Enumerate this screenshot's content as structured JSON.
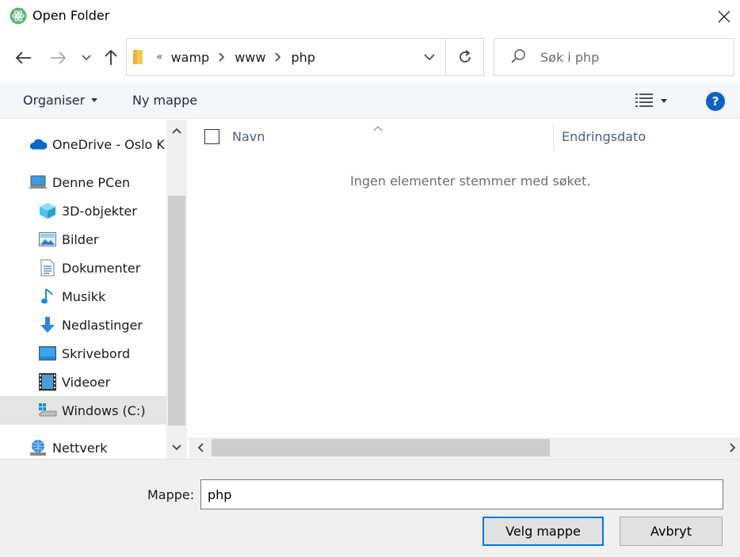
{
  "window": {
    "title": "Open Folder",
    "app_icon": "atom-icon",
    "close_icon": "close-icon"
  },
  "nav": {
    "back_icon": "arrow-left-icon",
    "forward_icon": "arrow-right-icon",
    "recent_icon": "chevron-down-icon",
    "up_icon": "arrow-up-icon"
  },
  "address": {
    "overflow": "«",
    "crumbs": [
      "wamp",
      "www",
      "php"
    ],
    "refresh_icon": "refresh-icon"
  },
  "search": {
    "placeholder": "Søk i php",
    "value": ""
  },
  "commands": {
    "organise": "Organiser",
    "new_folder": "Ny mappe",
    "help": "?"
  },
  "sidebar": {
    "items": [
      {
        "label": "OneDrive - Oslo K",
        "icon": "cloud-icon"
      },
      {
        "label": "Denne PCen",
        "icon": "computer-icon"
      },
      {
        "label": "3D-objekter",
        "icon": "cube-icon"
      },
      {
        "label": "Bilder",
        "icon": "pictures-icon"
      },
      {
        "label": "Dokumenter",
        "icon": "document-icon"
      },
      {
        "label": "Musikk",
        "icon": "music-note-icon"
      },
      {
        "label": "Nedlastinger",
        "icon": "download-arrow-icon"
      },
      {
        "label": "Skrivebord",
        "icon": "desktop-icon"
      },
      {
        "label": "Videoer",
        "icon": "film-icon"
      },
      {
        "label": "Windows (C:)",
        "icon": "drive-icon",
        "selected": true
      },
      {
        "label": "Nettverk",
        "icon": "network-icon"
      }
    ]
  },
  "list": {
    "columns": [
      "Navn",
      "Endringsdato"
    ],
    "empty_message": "Ingen elementer stemmer med søket."
  },
  "footer": {
    "folder_label": "Mappe:",
    "folder_value": "php",
    "select_button": "Velg mappe",
    "cancel_button": "Avbryt"
  },
  "colors": {
    "accent": "#0078d7",
    "help": "#0b63c4",
    "cmdbar_bg": "#f3f6fb",
    "footer_bg": "#f0f0f0"
  }
}
